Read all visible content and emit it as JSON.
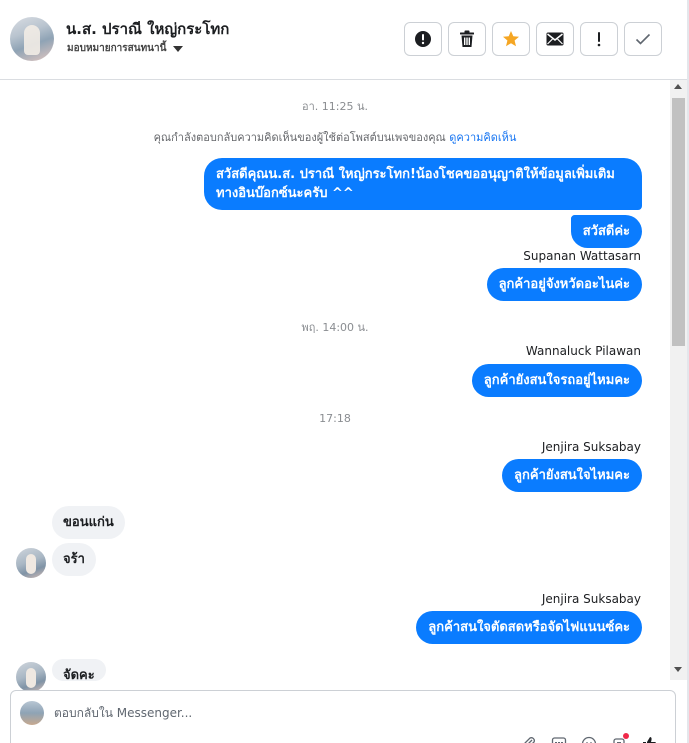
{
  "header": {
    "contact_name": "น.ส. ปราณี ใหญ่กระโทก",
    "assign_label": "มอบหมายการสนทนานี้",
    "tools": [
      {
        "name": "mark-spam-button",
        "icon": "alert-circle-icon"
      },
      {
        "name": "delete-button",
        "icon": "trash-icon"
      },
      {
        "name": "star-button",
        "icon": "star-icon",
        "color": "#f5a623"
      },
      {
        "name": "mark-unread-button",
        "icon": "envelope-icon"
      },
      {
        "name": "follow-up-button",
        "icon": "exclamation-icon"
      },
      {
        "name": "mark-done-button",
        "icon": "check-icon"
      }
    ]
  },
  "thread": {
    "ts1": "อา. 11:25 น.",
    "notice_text": "คุณกำลังตอบกลับความคิดเห็นของผู้ใช้ต่อโพสต์บนเพจของคุณ",
    "notice_link": "ดูความคิดเห็น",
    "msg1_line1": "สวัสดีคุณน.ส. ปราณี ใหญ่กระโทก!น้องโชคขออนุญาติให้ข้อมูลเพิ่มเติม",
    "msg1_line2": "ทางอินบ๊อกซ์นะครับ ^^",
    "msg2": "สวัสดีค่ะ",
    "sender1": "Supanan Wattasarn",
    "msg3": "ลูกค้าอยู่จังหวัดอะไนค่ะ",
    "ts2": "พฤ. 14:00 น.",
    "sender2": "Wannaluck Pilawan",
    "msg4": "ลูกค้ายังสนใจรถอยู่ไหมคะ",
    "ts3": "17:18",
    "sender3": "Jenjira Suksabay",
    "msg5": "ลูกค้ายังสนใจไหมคะ",
    "in1": "ขอนแก่น",
    "in2": "จร้า",
    "sender4": "Jenjira Suksabay",
    "msg6": "ลูกค้าสนใจตัดสดหรือจัดไฟแนนซ์คะ",
    "in3": "จัดคะ"
  },
  "reply": {
    "placeholder": "ตอบกลับใน Messenger..."
  },
  "colors": {
    "outgoing_bubble": "#0a7cff",
    "incoming_bubble": "#f0f2f5",
    "link": "#1876f2",
    "star": "#f5a623"
  }
}
